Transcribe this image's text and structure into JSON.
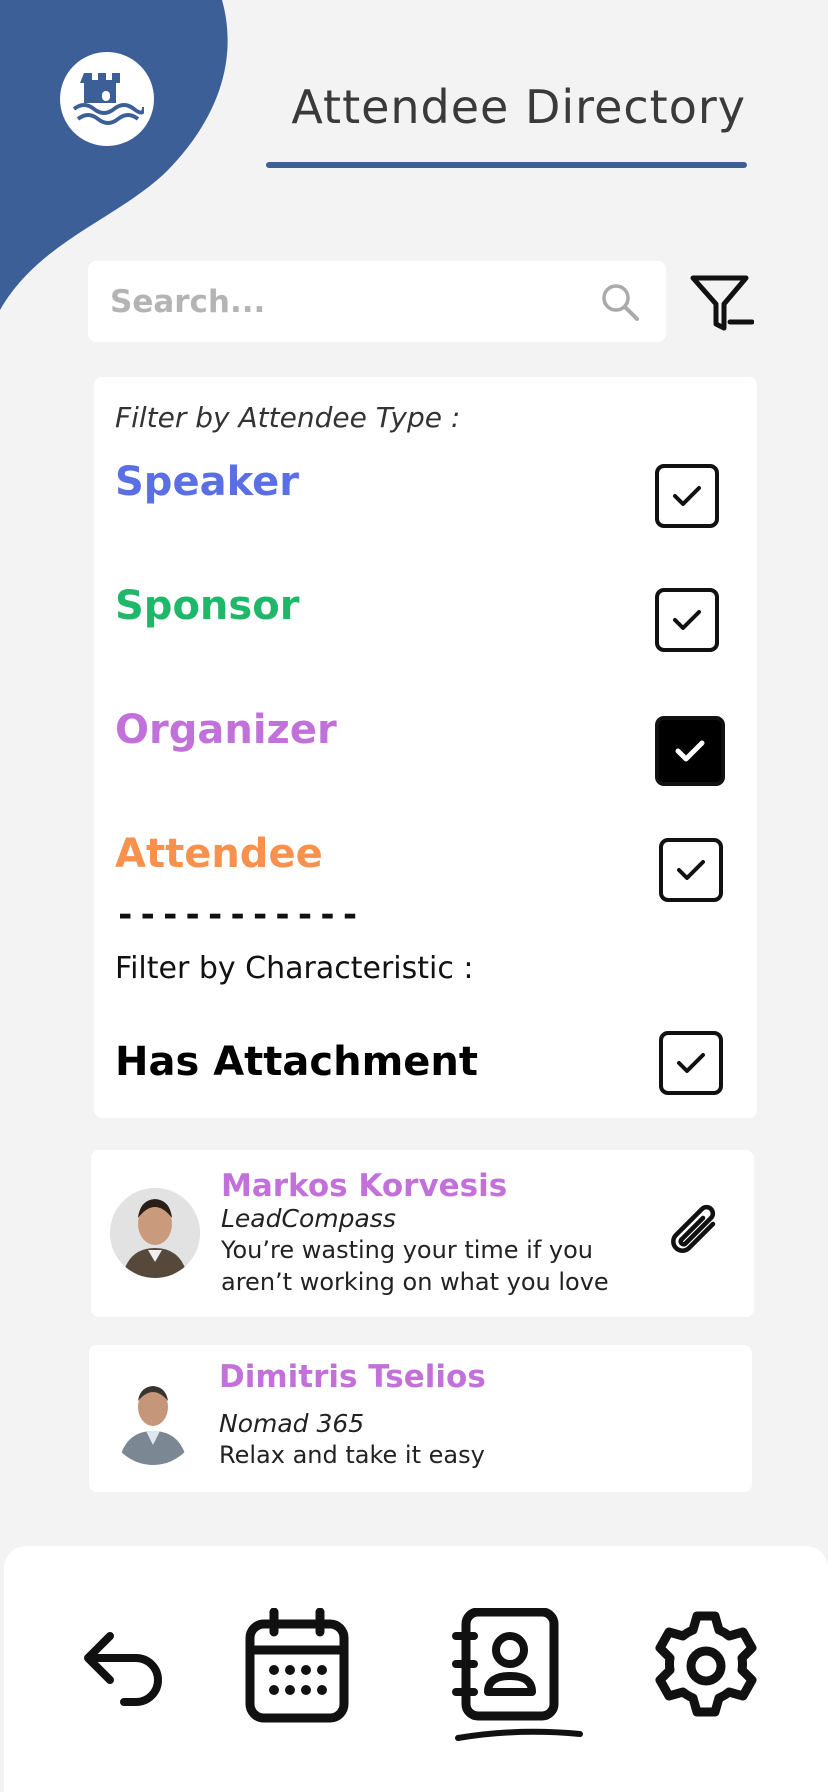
{
  "header": {
    "title": "Attendee Directory",
    "logo": "castle-wave-logo",
    "brand_color": "#3d5f98"
  },
  "search": {
    "placeholder": "Search...",
    "value": "",
    "icon": "search-icon"
  },
  "filter_button": {
    "icon": "filter-minus-icon"
  },
  "filters": {
    "type_heading": "Filter by Attendee Type :",
    "types": [
      {
        "label": "Speaker",
        "color": "#5b6fe4",
        "checked": true,
        "style": "outline"
      },
      {
        "label": "Sponsor",
        "color": "#1fb86a",
        "checked": true,
        "style": "outline"
      },
      {
        "label": "Organizer",
        "color": "#c171d9",
        "checked": true,
        "style": "filled"
      },
      {
        "label": "Attendee",
        "color": "#f7914d",
        "checked": true,
        "style": "outline"
      }
    ],
    "divider": "-----------",
    "characteristic_heading": "Filter by Characteristic :",
    "characteristics": [
      {
        "label": "Has Attachment",
        "checked": true
      }
    ]
  },
  "attendees": [
    {
      "name": "Markos Korvesis",
      "company": "LeadCompass",
      "quote": "You’re wasting your time if you aren’t working on what you love",
      "has_attachment": true,
      "name_color": "#c171d9"
    },
    {
      "name": "Dimitris Tselios",
      "company": "Nomad 365",
      "quote": "Relax and take it easy",
      "has_attachment": false,
      "name_color": "#c171d9"
    }
  ],
  "bottom_nav": {
    "items": [
      {
        "icon": "back-arrow-icon",
        "active": false
      },
      {
        "icon": "calendar-icon",
        "active": false
      },
      {
        "icon": "contacts-book-icon",
        "active": true
      },
      {
        "icon": "gear-icon",
        "active": false
      }
    ]
  }
}
